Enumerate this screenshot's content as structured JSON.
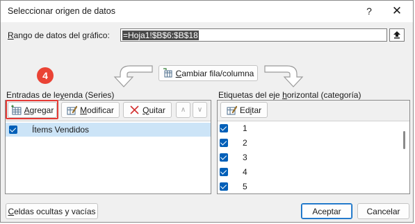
{
  "dialog": {
    "title": "Seleccionar origen de datos",
    "help": "?",
    "close": "✕"
  },
  "range": {
    "label_pre": "",
    "label_u": "R",
    "label_post": "ango de datos del gráfico:",
    "value": "=Hoja1!$B$6:$B$18"
  },
  "switch_button": {
    "pre": "",
    "u": "C",
    "post": "ambiar fila/columna"
  },
  "legend": {
    "header_pre": "Entradas de le",
    "header_u": "y",
    "header_post": "enda (Series)",
    "add": {
      "pre": "",
      "u": "A",
      "post": "gregar"
    },
    "edit": {
      "pre": "",
      "u": "M",
      "post": "odificar"
    },
    "remove": {
      "pre": "",
      "u": "Q",
      "post": "uitar"
    },
    "up": "∧",
    "down": "∨",
    "series": [
      {
        "label": "Ítems Vendidos",
        "checked": true,
        "selected": true
      }
    ]
  },
  "axis": {
    "header_pre": "Etiquetas del eje ",
    "header_u": "h",
    "header_post": "orizontal (categoría)",
    "edit": {
      "pre": "Ed",
      "u": "i",
      "post": "tar"
    },
    "items": [
      "1",
      "2",
      "3",
      "4",
      "5"
    ]
  },
  "hidden_cells": {
    "pre": "",
    "u": "C",
    "post": "eldas ocultas y vacías"
  },
  "accept": "Aceptar",
  "cancel": "Cancelar",
  "annotation": {
    "step": "4",
    "color": "#ea4335"
  },
  "colors": {
    "accent": "#005fb8",
    "selection": "#cce4f7",
    "dialog_bg": "#f0f0f0"
  }
}
